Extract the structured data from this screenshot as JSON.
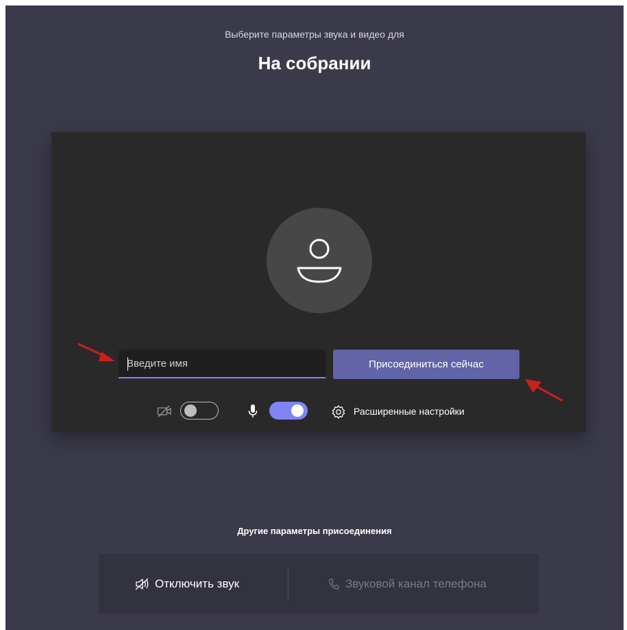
{
  "header": {
    "subtitle": "Выберите параметры звука и видео для",
    "meeting_title": "На собрании"
  },
  "prejoin": {
    "name_input": {
      "value": "",
      "placeholder": "Введите имя"
    },
    "join_button_label": "Присоединиться сейчас",
    "camera_toggle": {
      "on": false,
      "icon": "camera-off-icon"
    },
    "mic_toggle": {
      "on": true,
      "icon": "microphone-icon"
    },
    "advanced_settings_label": "Расширенные настройки",
    "advanced_settings_icon": "gear-icon",
    "avatar_icon": "person-icon"
  },
  "other_options": {
    "heading": "Другие параметры присоединения",
    "mute_label": "Отключить звук",
    "mute_icon": "speaker-off-icon",
    "phone_label": "Звуковой канал телефона",
    "phone_icon": "phone-icon"
  },
  "colors": {
    "background": "#3b3a4a",
    "card": "#292929",
    "accent": "#6264a7",
    "toggle_on": "#7f85f5",
    "annotation_arrow": "#c8211b"
  }
}
